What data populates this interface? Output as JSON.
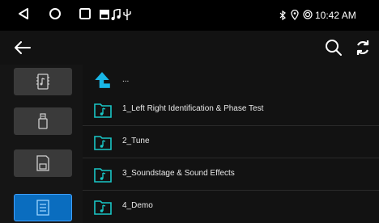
{
  "status_bar": {
    "icons": [
      "back-triangle-icon",
      "home-circle-icon",
      "recents-square-icon",
      "gallery-icon",
      "music-icon",
      "usb-icon"
    ],
    "right_icons": [
      "bluetooth-icon",
      "location-icon",
      "wifi-icon"
    ],
    "time": "10:42 AM"
  },
  "toolbar": {
    "back_icon": "arrow-left-icon",
    "search_icon": "search-icon",
    "refresh_icon": "refresh-icon"
  },
  "sidebar": {
    "items": [
      {
        "name": "sd-music-icon",
        "active": false
      },
      {
        "name": "usb-icon",
        "active": false
      },
      {
        "name": "sd-card-icon",
        "active": false
      },
      {
        "name": "file-list-icon",
        "active": true
      }
    ]
  },
  "file_list": {
    "up_label": "...",
    "folders": [
      {
        "label": "1_Left Right Identification & Phase Test"
      },
      {
        "label": "2_Tune"
      },
      {
        "label": "3_Soundstage & Sound Effects"
      },
      {
        "label": "4_Demo"
      }
    ]
  },
  "colors": {
    "accent": "#0a6dbf",
    "folder_icon": "#19c6c6",
    "up_arrow": "#19b6e6"
  }
}
